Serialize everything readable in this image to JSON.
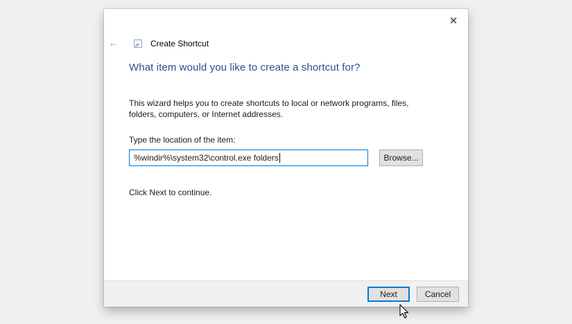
{
  "window": {
    "title": "Create Shortcut"
  },
  "icons": {
    "close": "✕",
    "back": "←",
    "shortcut_arrow": "↗"
  },
  "wizard": {
    "heading": "What item would you like to create a shortcut for?",
    "description": "This wizard helps you to create shortcuts to local or network programs, files, folders, computers, or Internet addresses.",
    "location_label": "Type the location of the item:",
    "location_value": "%windir%\\system32\\control.exe folders",
    "browse_label": "Browse...",
    "hint": "Click Next to continue.",
    "next_label": "Next",
    "cancel_label": "Cancel"
  },
  "colors": {
    "backdrop": "#f0f0f0",
    "dialog_background": "#ffffff",
    "heading_blue": "#2b508f",
    "focus_accent": "#0078d7",
    "button_face": "#e1e1e1",
    "button_border": "#adadad",
    "footer_background": "#f0f0f0"
  }
}
